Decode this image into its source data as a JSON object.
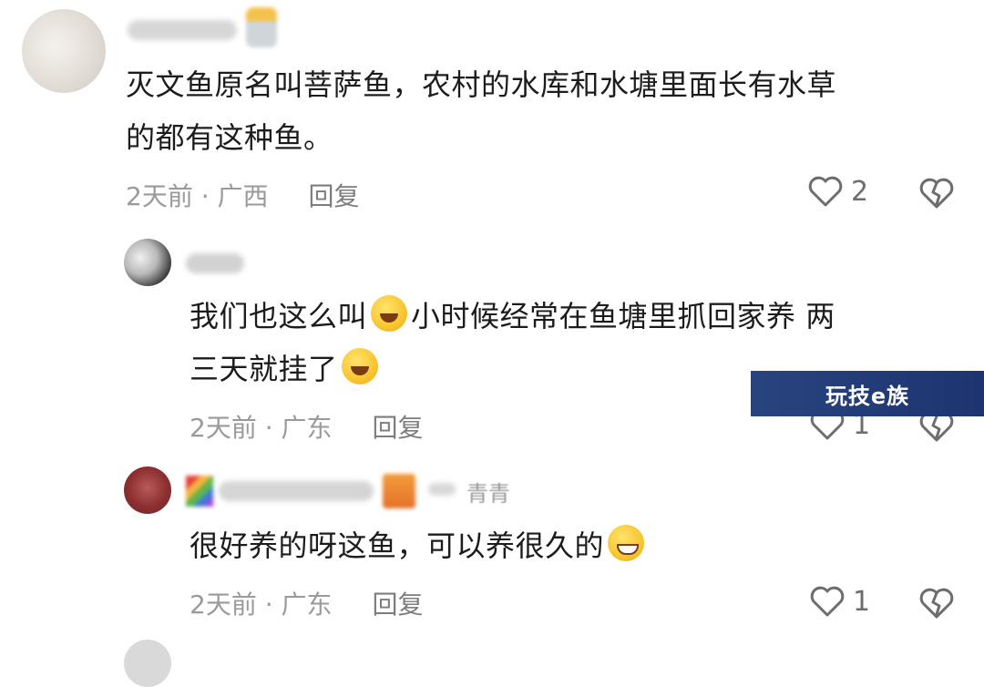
{
  "comments": [
    {
      "text_line1": "灭文鱼原名叫菩萨鱼，农村的水库和水塘里面长有水草",
      "text_line2": "的都有这种鱼。",
      "time_location": "2天前 · 广西",
      "reply_label": "回复",
      "like_count": "2"
    },
    {
      "text_line1_a": "我们也这么叫",
      "text_line1_b": "小时候经常在鱼塘里抓回家养 两",
      "text_line2": "三天就挂了",
      "time_location": "2天前 · 广东",
      "reply_label": "回复",
      "like_count": "1"
    },
    {
      "user_tag": "青青",
      "text_line1": "很好养的呀这鱼，可以养很久的",
      "time_location": "2天前 · 广东",
      "reply_label": "回复",
      "like_count": "1"
    }
  ],
  "watermark": "玩技e族",
  "icons": {
    "like": "heart-outline-icon",
    "dislike": "broken-heart-icon",
    "emojis": [
      "crying-laugh-emoji",
      "facepalm-emoji",
      "grin-emoji"
    ]
  },
  "colors": {
    "text": "#1c1c1c",
    "meta": "#9a9a9a",
    "watermark_bg": "#1d3470"
  }
}
